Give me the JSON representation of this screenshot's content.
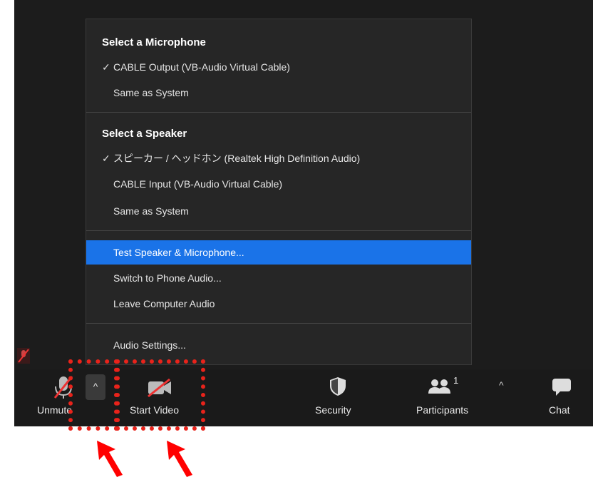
{
  "menu": {
    "microphone_title": "Select a Microphone",
    "microphone_items": [
      "CABLE Output (VB-Audio Virtual Cable)",
      "Same as System"
    ],
    "speaker_title": "Select a Speaker",
    "speaker_items": [
      "スピーカー / ヘッドホン (Realtek High Definition Audio)",
      "CABLE Input (VB-Audio Virtual Cable)",
      "Same as System"
    ],
    "actions": [
      "Test Speaker & Microphone...",
      "Switch to Phone Audio...",
      "Leave Computer Audio"
    ],
    "settings": "Audio Settings...",
    "check_mark": "✓",
    "highlight_color": "#1a73e8"
  },
  "toolbar": {
    "unmute_label": "Unmute",
    "start_video_label": "Start Video",
    "security_label": "Security",
    "participants_label": "Participants",
    "participants_count": "1",
    "chat_label": "Chat",
    "caret": "^"
  },
  "annotations": {
    "box_color": "#e8231b",
    "arrow_color": "#ff0000"
  }
}
